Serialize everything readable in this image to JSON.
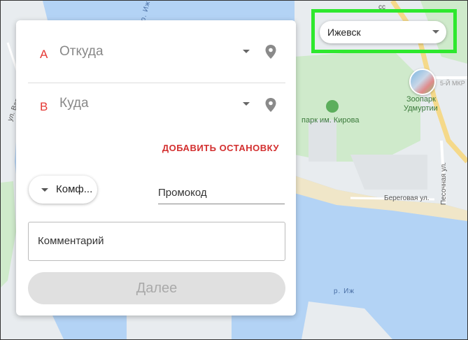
{
  "map": {
    "street_varaksino": "ул. Вараксино",
    "river_top": "р. Иж",
    "river_bottom": "р. Иж",
    "park": "парк им. Кирова",
    "zoo_line1": "Зоопарк",
    "zoo_line2": "Удмуртии",
    "district": "5-Й МКР",
    "beregovaya": "Береговая ул.",
    "pesochnaya": "Песочная ул.",
    "top_street_fragment": "сс"
  },
  "form": {
    "from": {
      "letter": "А",
      "placeholder": "Откуда"
    },
    "to": {
      "letter": "В",
      "placeholder": "Куда"
    },
    "add_stop": "ДОБАВИТЬ ОСТАНОВКУ",
    "tariff": "Комф...",
    "promo_label": "Промокод",
    "comment_label": "Комментарий",
    "next_button": "Далее"
  },
  "city_select": {
    "value": "Ижевск"
  },
  "colors": {
    "accent_red": "#e53935",
    "highlight_green": "#2ee82e",
    "water": "#b3d3f5",
    "land": "#e8ecef",
    "park": "#cfeacb"
  },
  "icons": {
    "pin": "location-pin-icon",
    "dropdown": "chevron-down-icon",
    "park": "tree-icon",
    "zoo": "zoo-photo-icon"
  }
}
